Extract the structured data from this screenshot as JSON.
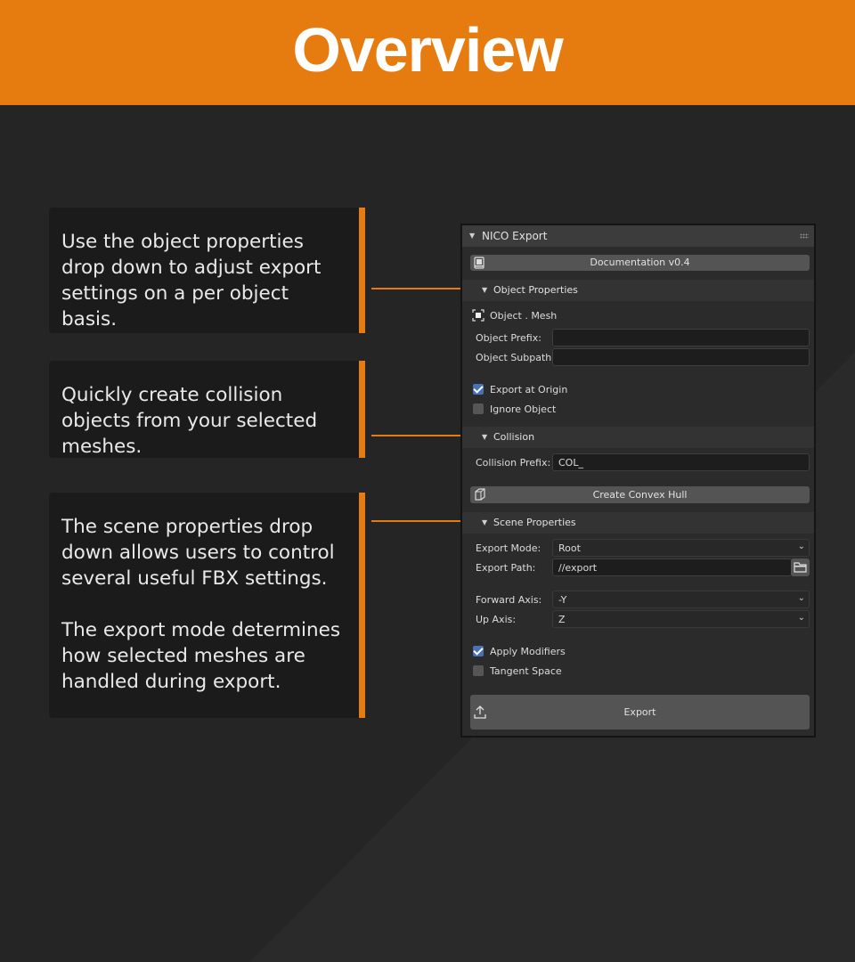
{
  "header": {
    "title": "Overview"
  },
  "callouts": [
    {
      "paragraphs": [
        "Use the object properties drop down to adjust export settings on a per object basis."
      ]
    },
    {
      "paragraphs": [
        "Quickly create collision objects from your selected meshes."
      ]
    },
    {
      "paragraphs": [
        "The scene properties drop down allows users to control several useful FBX settings.",
        "The export mode determines how selected meshes are handled during export."
      ]
    }
  ],
  "panel": {
    "title": "NICO Export",
    "documentation_button": "Documentation v0.4",
    "object_properties": {
      "title": "Object Properties",
      "object_label": "Object . Mesh",
      "prefix_label": "Object Prefix:",
      "prefix_value": "",
      "subpath_label": "Object Subpath:",
      "subpath_value": "",
      "export_at_origin": {
        "label": "Export at Origin",
        "checked": true
      },
      "ignore_object": {
        "label": "Ignore Object",
        "checked": false
      }
    },
    "collision": {
      "title": "Collision",
      "prefix_label": "Collision Prefix:",
      "prefix_value": "COL_",
      "convex_hull_button": "Create Convex Hull"
    },
    "scene_properties": {
      "title": "Scene Properties",
      "export_mode_label": "Export Mode:",
      "export_mode_value": "Root",
      "export_path_label": "Export Path:",
      "export_path_value": "//export",
      "forward_axis_label": "Forward Axis:",
      "forward_axis_value": "-Y",
      "up_axis_label": "Up Axis:",
      "up_axis_value": "Z",
      "apply_modifiers": {
        "label": "Apply Modifiers",
        "checked": true
      },
      "tangent_space": {
        "label": "Tangent Space",
        "checked": false
      }
    },
    "export_button": "Export"
  },
  "colors": {
    "accent": "#e67c10",
    "background": "#252525",
    "checkbox_on": "#4772b3"
  }
}
